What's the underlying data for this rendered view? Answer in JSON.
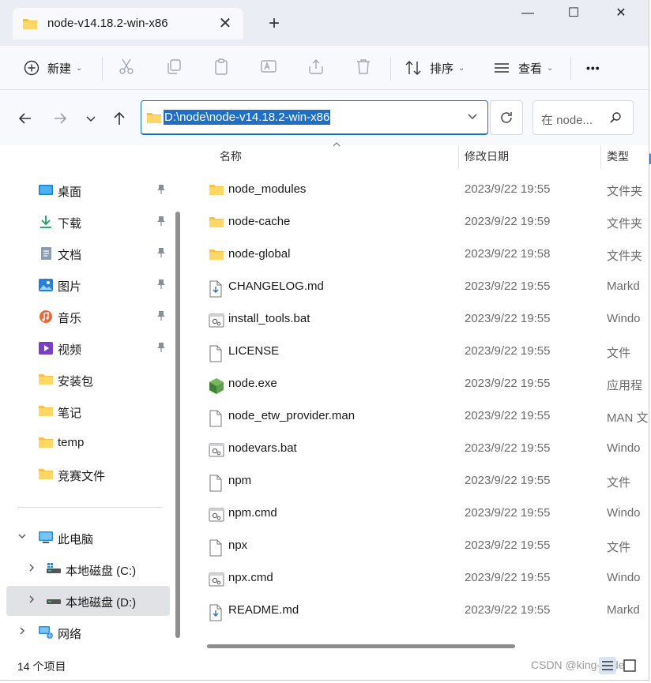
{
  "window": {
    "tab_title": "node-v14.18.2-win-x86",
    "new_tab_label": "+",
    "minimize_label": "—",
    "maximize_label": "☐",
    "close_label": "✕"
  },
  "toolbar": {
    "new_label": "新建",
    "sort_label": "排序",
    "view_label": "查看",
    "more_label": "•••"
  },
  "address": {
    "path": "D:\\node\\node-v14.18.2-win-x86",
    "search_placeholder": "在 node..."
  },
  "sidebar": {
    "quick_access": [
      {
        "label": "桌面",
        "icon": "desktop-icon",
        "pinned": true
      },
      {
        "label": "下载",
        "icon": "download-icon",
        "pinned": true
      },
      {
        "label": "文档",
        "icon": "document-icon",
        "pinned": true
      },
      {
        "label": "图片",
        "icon": "pictures-icon",
        "pinned": true
      },
      {
        "label": "音乐",
        "icon": "music-icon",
        "pinned": true
      },
      {
        "label": "视频",
        "icon": "video-icon",
        "pinned": true
      },
      {
        "label": "安装包",
        "icon": "folder-icon",
        "pinned": false
      },
      {
        "label": "笔记",
        "icon": "folder-icon",
        "pinned": false
      },
      {
        "label": "temp",
        "icon": "folder-icon",
        "pinned": false
      },
      {
        "label": "竞赛文件",
        "icon": "folder-icon",
        "pinned": false
      }
    ],
    "this_pc": "此电脑",
    "drive_c": "本地磁盘 (C:)",
    "drive_d": "本地磁盘 (D:)",
    "network": "网络"
  },
  "columns": {
    "name": "名称",
    "date": "修改日期",
    "type": "类型"
  },
  "files": [
    {
      "name": "node_modules",
      "date": "2023/9/22 19:55",
      "type": "文件夹",
      "icon": "folder-icon"
    },
    {
      "name": "node-cache",
      "date": "2023/9/22 19:59",
      "type": "文件夹",
      "icon": "folder-icon"
    },
    {
      "name": "node-global",
      "date": "2023/9/22 19:58",
      "type": "文件夹",
      "icon": "folder-icon"
    },
    {
      "name": "CHANGELOG.md",
      "date": "2023/9/22 19:55",
      "type": "Markd",
      "icon": "markdown-file-icon"
    },
    {
      "name": "install_tools.bat",
      "date": "2023/9/22 19:55",
      "type": "Windo",
      "icon": "batch-file-icon"
    },
    {
      "name": "LICENSE",
      "date": "2023/9/22 19:55",
      "type": "文件",
      "icon": "blank-file-icon"
    },
    {
      "name": "node.exe",
      "date": "2023/9/22 19:55",
      "type": "应用程",
      "icon": "node-exe-icon"
    },
    {
      "name": "node_etw_provider.man",
      "date": "2023/9/22 19:55",
      "type": "MAN 文",
      "icon": "blank-file-icon"
    },
    {
      "name": "nodevars.bat",
      "date": "2023/9/22 19:55",
      "type": "Windo",
      "icon": "batch-file-icon"
    },
    {
      "name": "npm",
      "date": "2023/9/22 19:55",
      "type": "文件",
      "icon": "blank-file-icon"
    },
    {
      "name": "npm.cmd",
      "date": "2023/9/22 19:55",
      "type": "Windo",
      "icon": "batch-file-icon"
    },
    {
      "name": "npx",
      "date": "2023/9/22 19:55",
      "type": "文件",
      "icon": "blank-file-icon"
    },
    {
      "name": "npx.cmd",
      "date": "2023/9/22 19:55",
      "type": "Windo",
      "icon": "batch-file-icon"
    },
    {
      "name": "README.md",
      "date": "2023/9/22 19:55",
      "type": "Markd",
      "icon": "markdown-file-icon"
    }
  ],
  "status": {
    "item_count": "14 个项目",
    "watermark": "CSDN @king-code"
  },
  "colors": {
    "accent": "#1f6fc5",
    "folder": "#f4c144",
    "node_green": "#5fa04e"
  }
}
